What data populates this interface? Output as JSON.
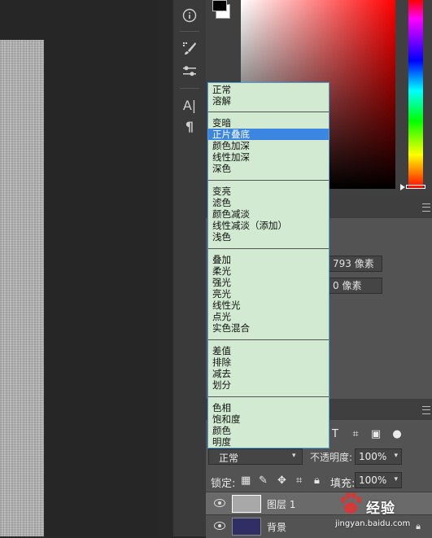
{
  "blend_menu": {
    "groups": [
      [
        "正常",
        "溶解"
      ],
      [
        "变暗",
        "正片叠底",
        "颜色加深",
        "线性加深",
        "深色"
      ],
      [
        "变亮",
        "滤色",
        "颜色减淡",
        "线性减淡（添加）",
        "浅色"
      ],
      [
        "叠加",
        "柔光",
        "强光",
        "亮光",
        "线性光",
        "点光",
        "实色混合"
      ],
      [
        "差值",
        "排除",
        "减去",
        "划分"
      ],
      [
        "色相",
        "饱和度",
        "颜色",
        "明度"
      ]
    ],
    "selected": "正片叠底"
  },
  "properties": {
    "width_value": "793 像素",
    "height_value": "0 像素"
  },
  "layers_panel": {
    "blend_mode": "正常",
    "opacity_label": "不透明度:",
    "opacity_value": "100%",
    "lock_label": "锁定:",
    "fill_label": "填充:",
    "fill_value": "100%",
    "layers": [
      {
        "name": "图层 1",
        "thumb_color": "#a8a8a8"
      },
      {
        "name": "背景",
        "thumb_color": "#2f2f66"
      }
    ]
  },
  "toolbar": {
    "icons": [
      "info-icon",
      "brush-settings-icon",
      "adjust-sliders-icon",
      "character-icon",
      "paragraph-icon"
    ],
    "character_label": "A|",
    "paragraph_label": "¶"
  },
  "colors": {
    "fg": "#000000",
    "bg": "#ffffff",
    "dropdown_bg": "#d1ead1",
    "dropdown_border": "#4a9fd8",
    "selection": "#3a86e0",
    "panel": "#535353"
  },
  "watermark": {
    "brand": "经验",
    "url": "jingyan.baidu.com"
  }
}
